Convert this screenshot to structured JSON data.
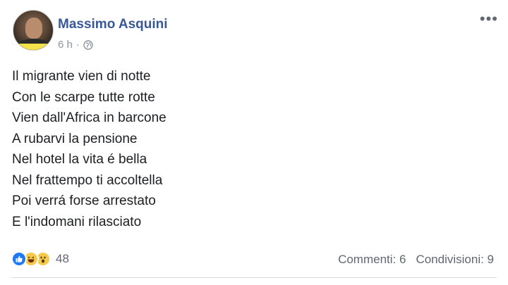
{
  "post": {
    "author": "Massimo Asquini",
    "time": "6 h",
    "separator": "·",
    "privacy_icon": "globe-icon",
    "more_icon": "more-options-icon",
    "text_lines": [
      "Il migrante vien di notte",
      "Con le scarpe tutte rotte",
      "Vien dall'Africa in barcone",
      "A rubarvi la pensione",
      "Nel hotel la vita é bella",
      "Nel frattempo ti accoltella",
      "Poi verrá forse arrestato",
      "E l'indomani rilasciato"
    ]
  },
  "reactions": {
    "icons": [
      "like-icon",
      "haha-icon",
      "wow-icon"
    ],
    "count": "48"
  },
  "stats": {
    "comments": "Commenti: 6",
    "shares": "Condivisioni: 9"
  },
  "colors": {
    "author": "#385898",
    "like": "#2078f4",
    "emoji": "#f7c948",
    "muted": "#606770"
  }
}
